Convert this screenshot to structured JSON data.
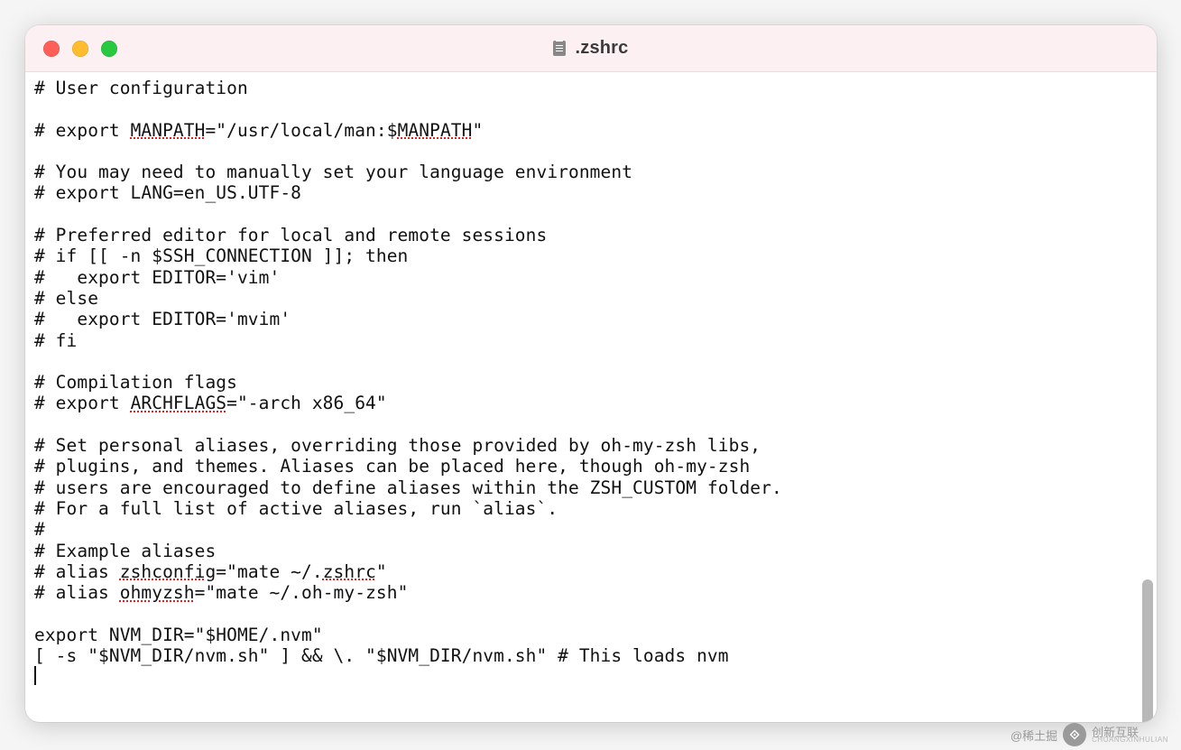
{
  "window": {
    "title": ".zshrc"
  },
  "editor": {
    "lines": [
      "# User configuration",
      "",
      "# export MANPATH=\"/usr/local/man:$MANPATH\"",
      "",
      "# You may need to manually set your language environment",
      "# export LANG=en_US.UTF-8",
      "",
      "# Preferred editor for local and remote sessions",
      "# if [[ -n $SSH_CONNECTION ]]; then",
      "#   export EDITOR='vim'",
      "# else",
      "#   export EDITOR='mvim'",
      "# fi",
      "",
      "# Compilation flags",
      "# export ARCHFLAGS=\"-arch x86_64\"",
      "",
      "# Set personal aliases, overriding those provided by oh-my-zsh libs,",
      "# plugins, and themes. Aliases can be placed here, though oh-my-zsh",
      "# users are encouraged to define aliases within the ZSH_CUSTOM folder.",
      "# For a full list of active aliases, run `alias`.",
      "#",
      "# Example aliases",
      "# alias zshconfig=\"mate ~/.zshrc\"",
      "# alias ohmyzsh=\"mate ~/.oh-my-zsh\"",
      "",
      "export NVM_DIR=\"$HOME/.nvm\"",
      "[ -s \"$NVM_DIR/nvm.sh\" ] && \\. \"$NVM_DIR/nvm.sh\" # This loads nvm"
    ],
    "spellcheck_words": [
      "MANPATH",
      "ARCHFLAGS",
      "zshconfig",
      "zshrc",
      "ohmyzsh"
    ]
  },
  "watermark": {
    "prefix": "@稀土掘",
    "brand_top": "创新互联",
    "brand_sub": "CHUANGXINHULIAN"
  }
}
